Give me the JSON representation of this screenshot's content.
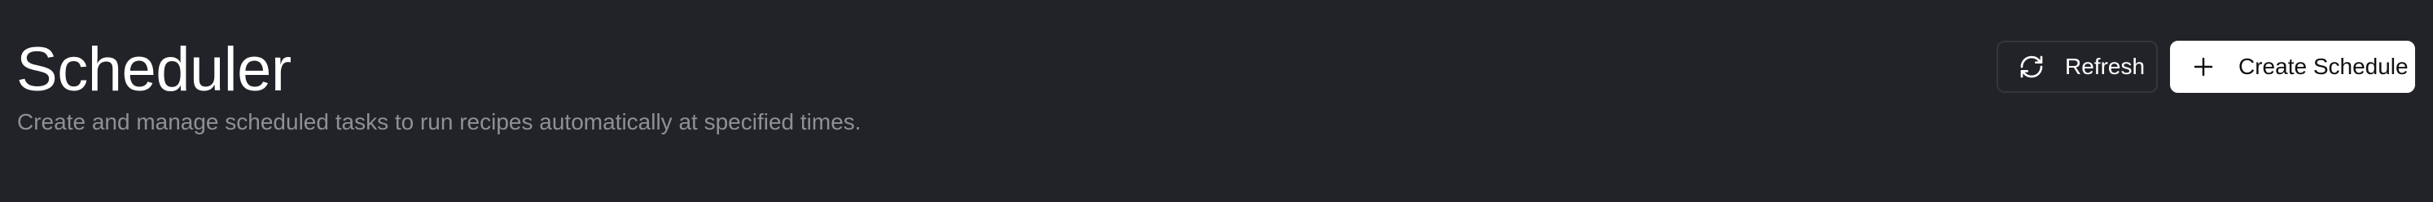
{
  "header": {
    "title": "Scheduler",
    "subtitle": "Create and manage scheduled tasks to run recipes automatically at specified times."
  },
  "actions": {
    "refresh": {
      "label": "Refresh",
      "icon": "refresh-icon"
    },
    "create": {
      "label": "Create Schedule",
      "icon": "plus-icon"
    }
  },
  "colors": {
    "background": "#222328",
    "title_text": "#ffffff",
    "subtitle_text": "#8e9096",
    "primary_button_bg": "#ffffff",
    "primary_button_text": "#111114",
    "secondary_button_border": "#34363c"
  }
}
